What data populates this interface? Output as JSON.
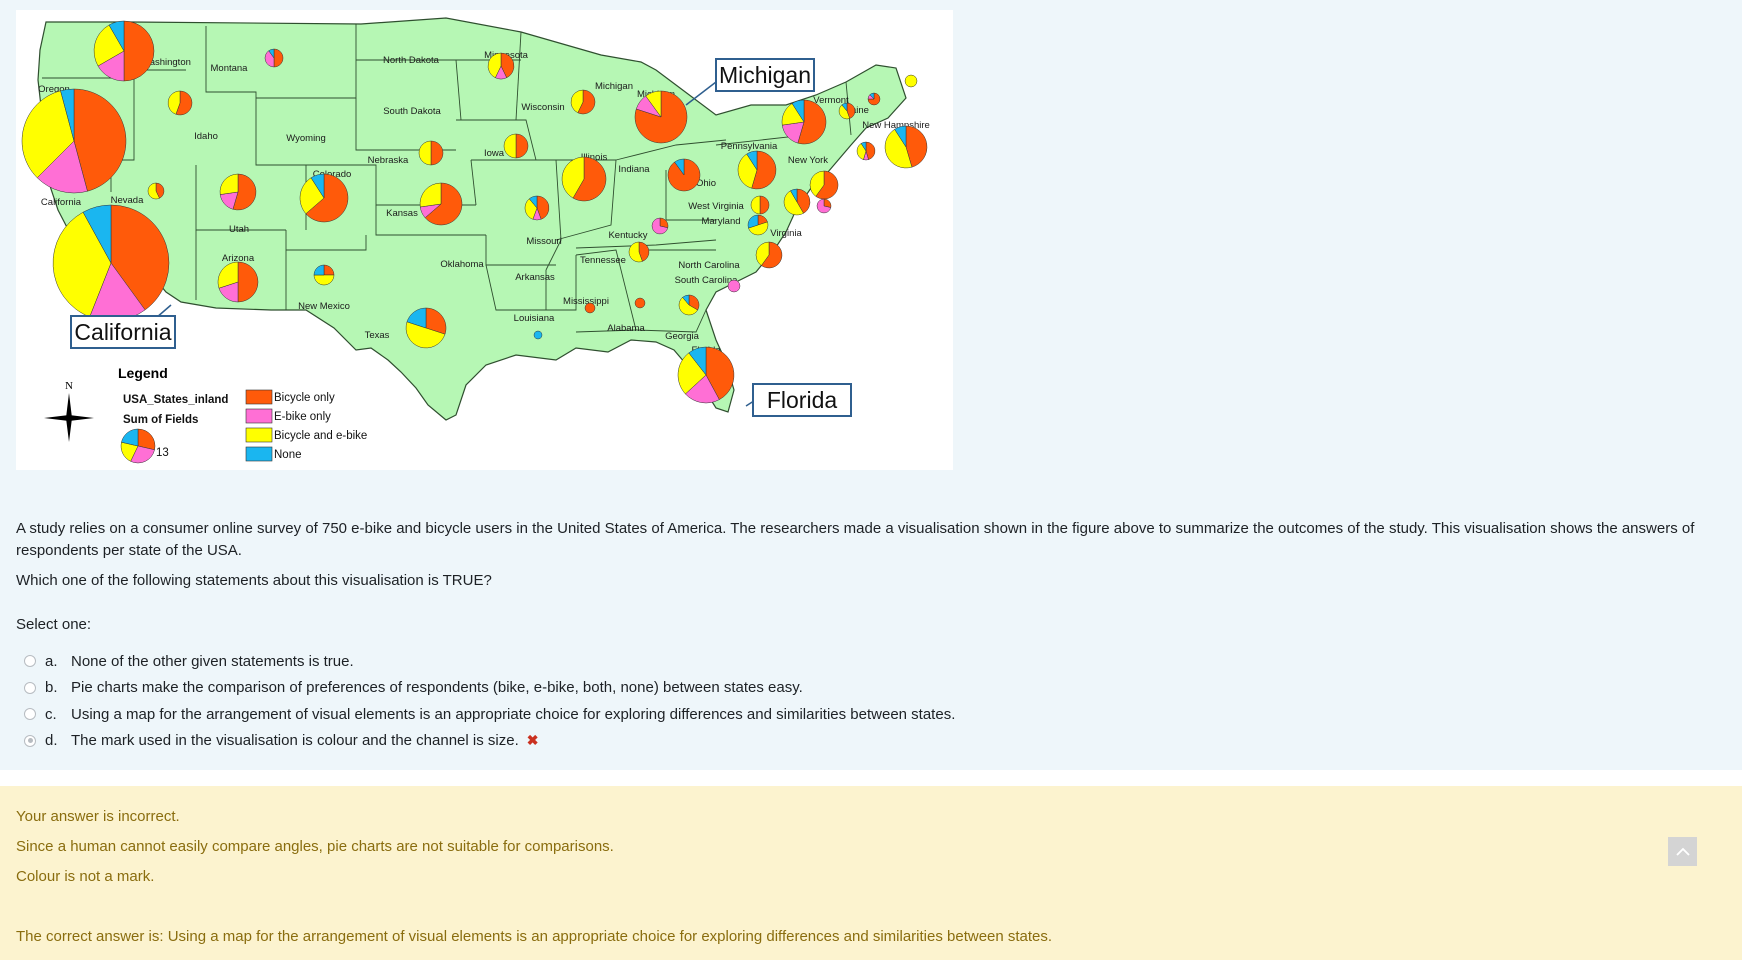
{
  "map": {
    "state_labels": [
      "Washington",
      "Montana",
      "Oregon",
      "North Dakota",
      "Minnesota",
      "Michigan",
      "Michigan",
      "Idaho",
      "Wyoming",
      "South Dakota",
      "Wisconsin",
      "Vermont",
      "Maine",
      "New Hampshire",
      "Iowa",
      "Nebraska",
      "Illinois",
      "Indiana",
      "Pennsylvania",
      "New York",
      "Colorado",
      "Ohio",
      "California",
      "Nevada",
      "Kansas",
      "West Virginia",
      "Maryland",
      "Virginia",
      "Utah",
      "Missouri",
      "Kentucky",
      "Arizona",
      "Oklahoma",
      "Arkansas",
      "Tennessee",
      "North Carolina",
      "South Carolina",
      "New Mexico",
      "Mississippi",
      "Louisiana",
      "Alabama",
      "Georgia",
      "Texas",
      "Florida"
    ],
    "callouts": {
      "michigan": "Michigan",
      "california": "California",
      "florida": "Florida"
    },
    "north_label": "N",
    "legend": {
      "title": "Legend",
      "layer": "USA_States_inland",
      "size_title": "Sum of Fields",
      "size_value": "13",
      "items": [
        {
          "label": "Bicycle only",
          "color": "#ff5a0a"
        },
        {
          "label": "E-bike only",
          "color": "#ff6fd5"
        },
        {
          "label": "Bicycle and e-bike",
          "color": "#ffff00"
        },
        {
          "label": "None",
          "color": "#1ab6f0"
        }
      ]
    },
    "colors": {
      "land": "#b6f7b4",
      "border": "#2f4f2f",
      "callout_border": "#2f5f8f"
    }
  },
  "question": {
    "text1": "A study relies on a consumer online survey of 750 e-bike and bicycle users in the United States of America. The researchers made a visualisation shown in the figure above to summarize the outcomes of the study. This visualisation shows the answers of respondents per state of the USA.",
    "text2": "Which one of the following statements about this visualisation is TRUE?",
    "prompt": "Select one:",
    "answers": [
      {
        "letter": "a.",
        "text": "None of the other given statements is true."
      },
      {
        "letter": "b.",
        "text": "Pie charts make the comparison of preferences of respondents (bike, e-bike, both, none) between states easy."
      },
      {
        "letter": "c.",
        "text": "Using a map for the arrangement of visual elements is an appropriate choice for exploring differences and similarities between states."
      },
      {
        "letter": "d.",
        "text": "The mark used in the visualisation is colour and the channel is size."
      }
    ],
    "selected": "d",
    "wrong_icon": "cross-icon"
  },
  "feedback": {
    "status": "Your answer is incorrect.",
    "line1": "Since a human cannot easily compare angles, pie charts are not suitable for comparisons.",
    "line2": "Colour is not a mark.",
    "correct": "The correct answer is: Using a map for the arrangement of visual elements is an appropriate choice for exploring differences and similarities between states."
  }
}
